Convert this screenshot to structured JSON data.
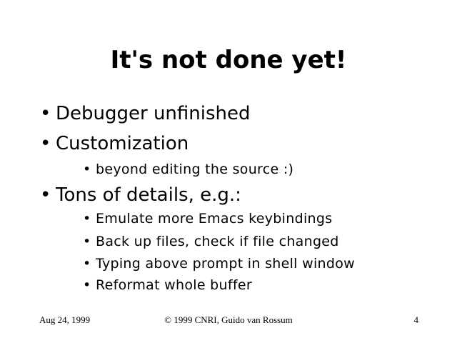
{
  "slide": {
    "title": "It's not done yet!",
    "bullet_glyph": "•",
    "items": [
      {
        "text": "Debugger unfinished"
      },
      {
        "text": "Customization",
        "subitems": [
          {
            "text": "beyond editing the source :)"
          }
        ]
      },
      {
        "text": "Tons of details, e.g.:",
        "subitems": [
          {
            "text": "Emulate more Emacs keybindings"
          },
          {
            "text": "Back up files, check if file changed"
          },
          {
            "text": "Typing above prompt in shell window"
          },
          {
            "text": "Reformat whole buffer"
          }
        ]
      }
    ],
    "footer": {
      "date": "Aug 24, 1999",
      "copyright": "© 1999 CNRI, Guido van Rossum",
      "page_number": "4"
    }
  }
}
